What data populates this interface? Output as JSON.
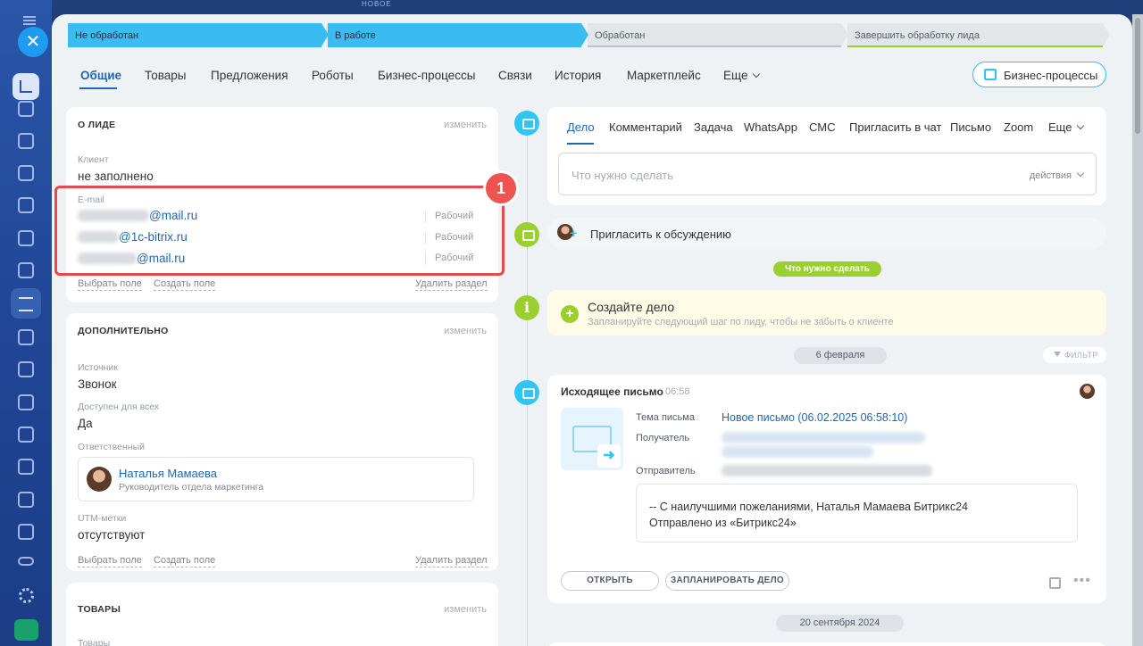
{
  "window": {
    "top_mark": "НОВОЕ"
  },
  "stages": [
    {
      "label": "Не обработан"
    },
    {
      "label": "В работе"
    },
    {
      "label": "Обработан"
    },
    {
      "label": "Завершить обработку лида"
    }
  ],
  "tabs": [
    "Общие",
    "Товары",
    "Предложения",
    "Роботы",
    "Бизнес-процессы",
    "Связи",
    "История",
    "Маркетплейс",
    "Еще"
  ],
  "bp_button": "Бизнес-процессы",
  "about": {
    "title": "О ЛИДЕ",
    "edit": "изменить",
    "client_label": "Клиент",
    "client_value": "не заполнено",
    "email_label": "E-mail",
    "emails": [
      {
        "domain": "@mail.ru",
        "type": "Рабочий"
      },
      {
        "domain": "@1c-bitrix.ru",
        "type": "Рабочий"
      },
      {
        "domain": "@mail.ru",
        "type": "Рабочий"
      }
    ],
    "select_field": "Выбрать поле",
    "create_field": "Создать поле",
    "delete_section": "Удалить раздел",
    "badge": "1"
  },
  "extra": {
    "title": "ДОПОЛНИТЕЛЬНО",
    "edit": "изменить",
    "source_label": "Источник",
    "source_value": "Звонок",
    "avail_label": "Доступен для всех",
    "avail_value": "Да",
    "resp_label": "Ответственный",
    "resp_name": "Наталья Мамаева",
    "resp_role": "Руководитель отдела маркетинга",
    "utm_label": "UTM-метки",
    "utm_value": "отсутствуют",
    "select_field": "Выбрать поле",
    "create_field": "Создать поле",
    "delete_section": "Удалить раздел"
  },
  "goods": {
    "title": "ТОВАРЫ",
    "edit": "изменить",
    "label": "Товары"
  },
  "activity_tabs": [
    "Дело",
    "Комментарий",
    "Задача",
    "WhatsApp",
    "СМС",
    "Пригласить в чат",
    "Письмо",
    "Zoom",
    "Еще"
  ],
  "todo": {
    "placeholder": "Что нужно сделать",
    "actions": "действия"
  },
  "invite": "Пригласить к обсуждению",
  "todo_pill": "Что нужно сделать",
  "create": {
    "title": "Создайте дело",
    "subtitle": "Запланируйте следующий шаг по лиду, чтобы не забыть о клиенте"
  },
  "date1": "6 февраля",
  "filter": "ФИЛЬТР",
  "mail": {
    "title": "Исходящее письмо",
    "time": "06:58",
    "subject_label": "Тема письма",
    "subject_value": "Новое письмо (06.02.2025 06:58:10)",
    "recipient_label": "Получатель",
    "sender_label": "Отправитель",
    "body_line1": "--  С наилучшими пожеланиями, Наталья Мамаева  Битрикс24",
    "body_line2": "Отправлено из «Битрикс24»",
    "open_btn": "ОТКРЫТЬ",
    "plan_btn": "ЗАПЛАНИРОВАТЬ ДЕЛО",
    "more": "•••"
  },
  "date2": "20 сентября 2024"
}
